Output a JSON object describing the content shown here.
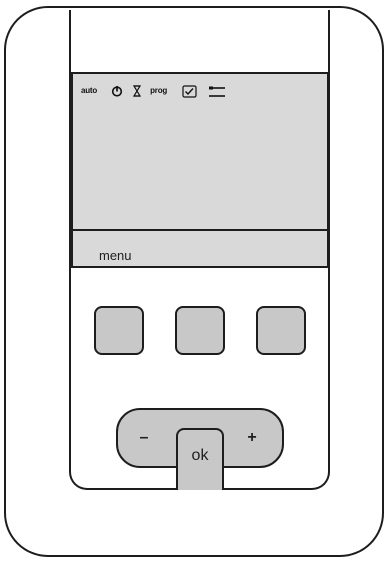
{
  "lcd": {
    "status_icons": [
      {
        "type": "text",
        "label": "auto"
      },
      {
        "type": "icon",
        "name": "power-timer-icon"
      },
      {
        "type": "icon",
        "name": "hourglass-icon"
      },
      {
        "type": "text",
        "label": "prog"
      },
      {
        "type": "icon",
        "name": "checkbox-icon"
      },
      {
        "type": "icon",
        "name": "settings-tool-icon",
        "underlined": true
      }
    ],
    "softkey_label": "menu"
  },
  "buttons": {
    "softkeys": [
      "softkey-left",
      "softkey-middle",
      "softkey-right"
    ],
    "minus_label": "–",
    "plus_label": "+",
    "ok_label": "ok"
  },
  "colors": {
    "lcd_background": "#d9d9d9",
    "button_fill": "#c8c8c8",
    "outline": "#1d1d1d"
  }
}
